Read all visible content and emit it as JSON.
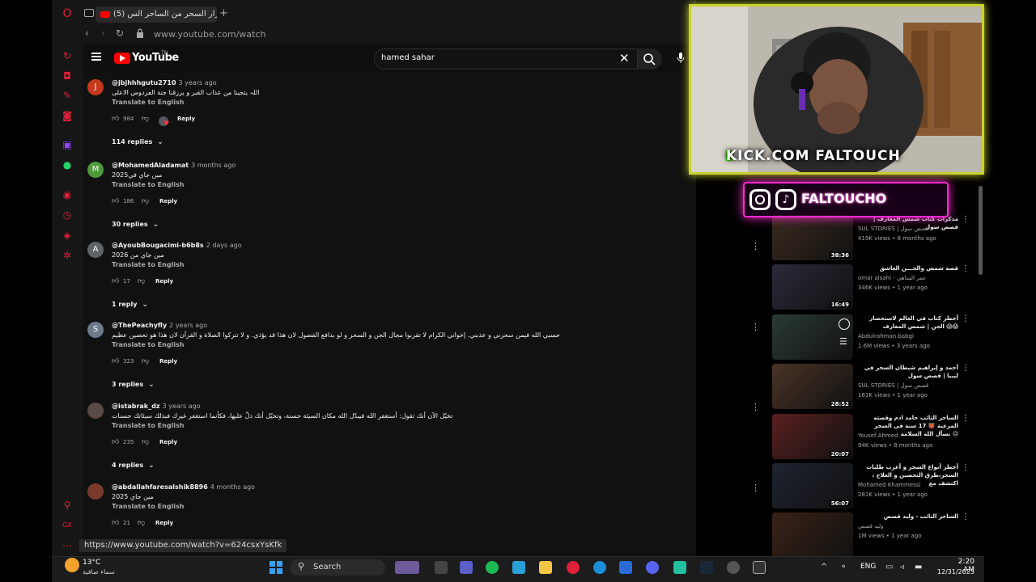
{
  "browser": {
    "tab_title": "(5) أسرار السحر من الساحر الس",
    "new_tab": "+",
    "url": "www.youtube.com/watch",
    "status_url": "https://www.youtube.com/watch?v=624csxYsKfk"
  },
  "youtube": {
    "logo_text": "YouTube",
    "logo_suffix": "TN",
    "search_value": "hamed sahar"
  },
  "comments": [
    {
      "initial": "J",
      "color": "#c5391f",
      "author": "@jbjhhhgutu2710",
      "when": "3 years ago",
      "text": "اللہ يتجينا من عذاب القبر و يرزقنا جنة الفردوس الاعلى",
      "translate": "Translate to English",
      "likes": "984",
      "reply": "Reply",
      "replies": "114 replies"
    },
    {
      "initial": "M",
      "color": "#4f9a3b",
      "author": "@MohamedAladamat",
      "when": "3 months ago",
      "text": "مين جاي في2025",
      "translate": "Translate to English",
      "likes": "186",
      "reply": "Reply",
      "replies": "30 replies"
    },
    {
      "initial": "A",
      "color": "#5f6368",
      "author": "@AyoubBougacimi-b6b8s",
      "when": "2 days ago",
      "text": "مين جاي من 2026",
      "translate": "Translate to English",
      "likes": "17",
      "reply": "Reply",
      "replies": "1 reply"
    },
    {
      "initial": "S",
      "color": "#6c7a89",
      "author": "@ThePeachyfly",
      "when": "2 years ago",
      "text": "حسبي الله فيمن سحرني و عذبني. إخواني الكرام لا تقربوا مجال الجن و السحر و لو بدافع الفضول لان هذا قد يؤذي. و لا تتركوا الصلاة و القرآن لان هذا هو تحصين عظيم",
      "translate": "Translate to English",
      "likes": "323",
      "reply": "Reply",
      "replies": "3 replies"
    },
    {
      "initial": "",
      "color": "#5a4a46",
      "author": "@istabrak_dz",
      "when": "3 years ago",
      "text": "تخيّل الآن أنك تقول: أستغفر الله فيبدّل الله مكان السيئة حسنة، وتخيّل أنك دلّ عليها، فكأنما استغفر غيرك فبذلك سيئاتك حسنات",
      "translate": "Translate to English",
      "likes": "235",
      "reply": "Reply",
      "replies": "4 replies"
    },
    {
      "initial": "",
      "color": "#7a3a2a",
      "author": "@abdallahfaresalshik8896",
      "when": "4 months ago",
      "text": "مين جاي 2025",
      "translate": "Translate to English",
      "likes": "21",
      "reply": "Reply",
      "replies": ""
    }
  ],
  "recommended": [
    {
      "title": "مذكرات كتاب شمس المعارف | قصص سول",
      "channel": "SUL STORIES | قصص سول",
      "meta": "419K views • 8 months ago",
      "duration": "38:36",
      "thumb": "#3a2a1e"
    },
    {
      "title": "قصة شمس والجـــن العاشق",
      "channel": "omar alsahi - عمر الساهي",
      "meta": "346K views • 1 year ago",
      "duration": "16:49",
      "thumb": "#2a2a3a"
    },
    {
      "title": "أخطر كتاب في العالم لاستحضار الجن | شمس المعارف 😱😱",
      "channel": "Abdulrahman babgi",
      "meta": "1.6M views • 3 years ago",
      "duration": "",
      "thumb": "#2b3a36"
    },
    {
      "title": "أحمد و إبراهيم شيطان السحر في ليبيا | قصص سول",
      "channel": "SUL STORIES | قصص سول",
      "meta": "161K views • 1 year ago",
      "duration": "28:52",
      "thumb": "#4a3426"
    },
    {
      "title": "الساحر التائب حامد ادم وقصته المرعبة 👹 17 سنة في السحر نسأل الله السلامة 😥",
      "channel": "Yousef Ahmed",
      "meta": "94K views • 8 months ago",
      "duration": "20:07",
      "thumb": "#5a2020"
    },
    {
      "title": "أخطر أنواع السحر و أغرب طلبات السحر،طرق التحصين و العلاج ، اكتشف مع",
      "channel": "Mohamed Khammessi",
      "meta": "281K views • 1 year ago",
      "duration": "56:07",
      "thumb": "#1e2430"
    },
    {
      "title": "الساحر التائب - وليد قصص",
      "channel": "وليد قصص",
      "meta": "1M views • 1 year ago",
      "duration": "",
      "thumb": "#3a2216"
    }
  ],
  "overlay": {
    "cam_handle": "KICK.COM FALTOUCH",
    "social_handle": "FALTOUCHO"
  },
  "taskbar": {
    "temperature": "13°C",
    "weather": "سماء صافية",
    "search_label": "Search",
    "language": "ENG",
    "time": "2:20 AM",
    "date": "12/31/2025"
  }
}
